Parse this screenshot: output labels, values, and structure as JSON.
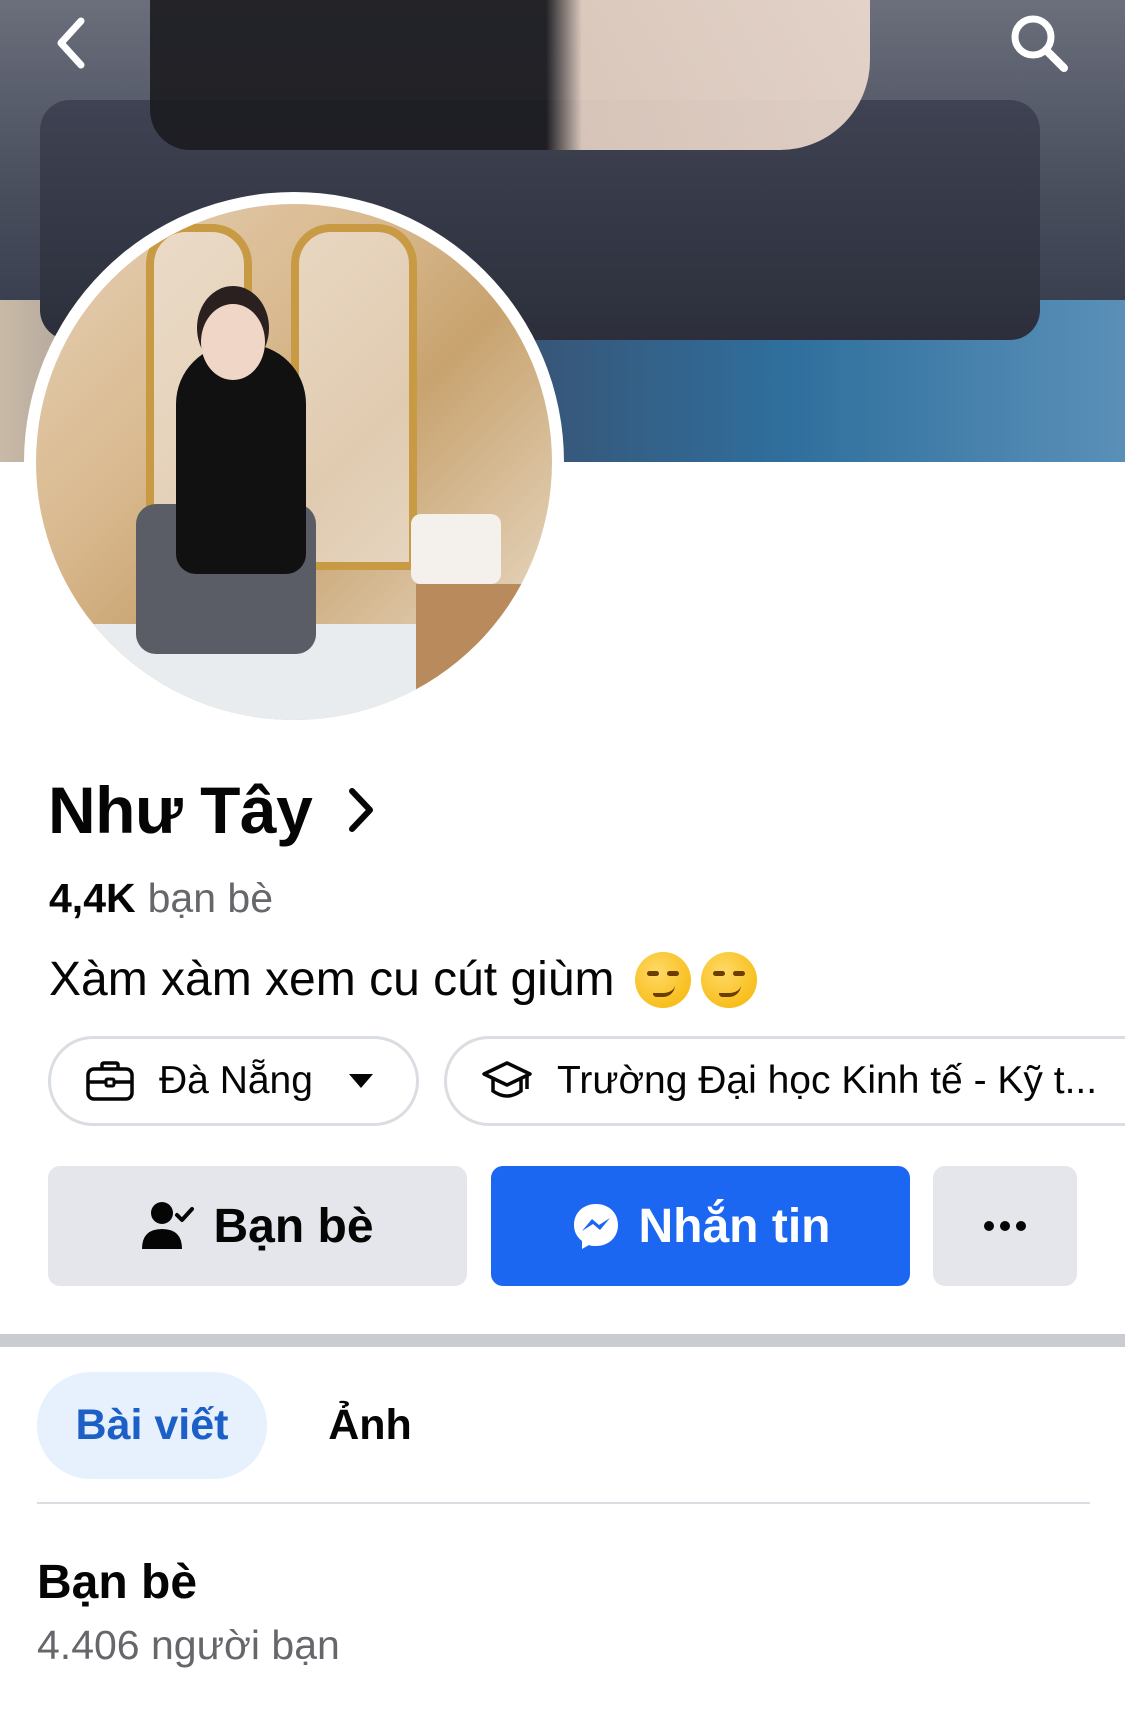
{
  "header": {
    "back_icon": "chevron-left-icon",
    "search_icon": "search-icon"
  },
  "profile": {
    "name": "Như Tây",
    "friends_count": "4,4K",
    "friends_label": "bạn bè",
    "bio": "Xàm xàm xem cu cút giùm"
  },
  "chips": {
    "location": "Đà Nẵng",
    "school": "Trường Đại học Kinh tế - Kỹ t..."
  },
  "actions": {
    "friends_button": "Bạn bè",
    "message_button": "Nhắn tin",
    "more_button": "more-icon"
  },
  "tabs": [
    {
      "label": "Bài viết",
      "active": true
    },
    {
      "label": "Ảnh",
      "active": false
    }
  ],
  "friends_section": {
    "title": "Bạn bè",
    "subtitle": "4.406 người bạn"
  },
  "colors": {
    "primary": "#1b67f2",
    "secondary_button": "#e4e6eb",
    "active_tab_bg": "#e7f0fd",
    "active_tab_text": "#1b5fc7",
    "muted_text": "#65676b"
  }
}
